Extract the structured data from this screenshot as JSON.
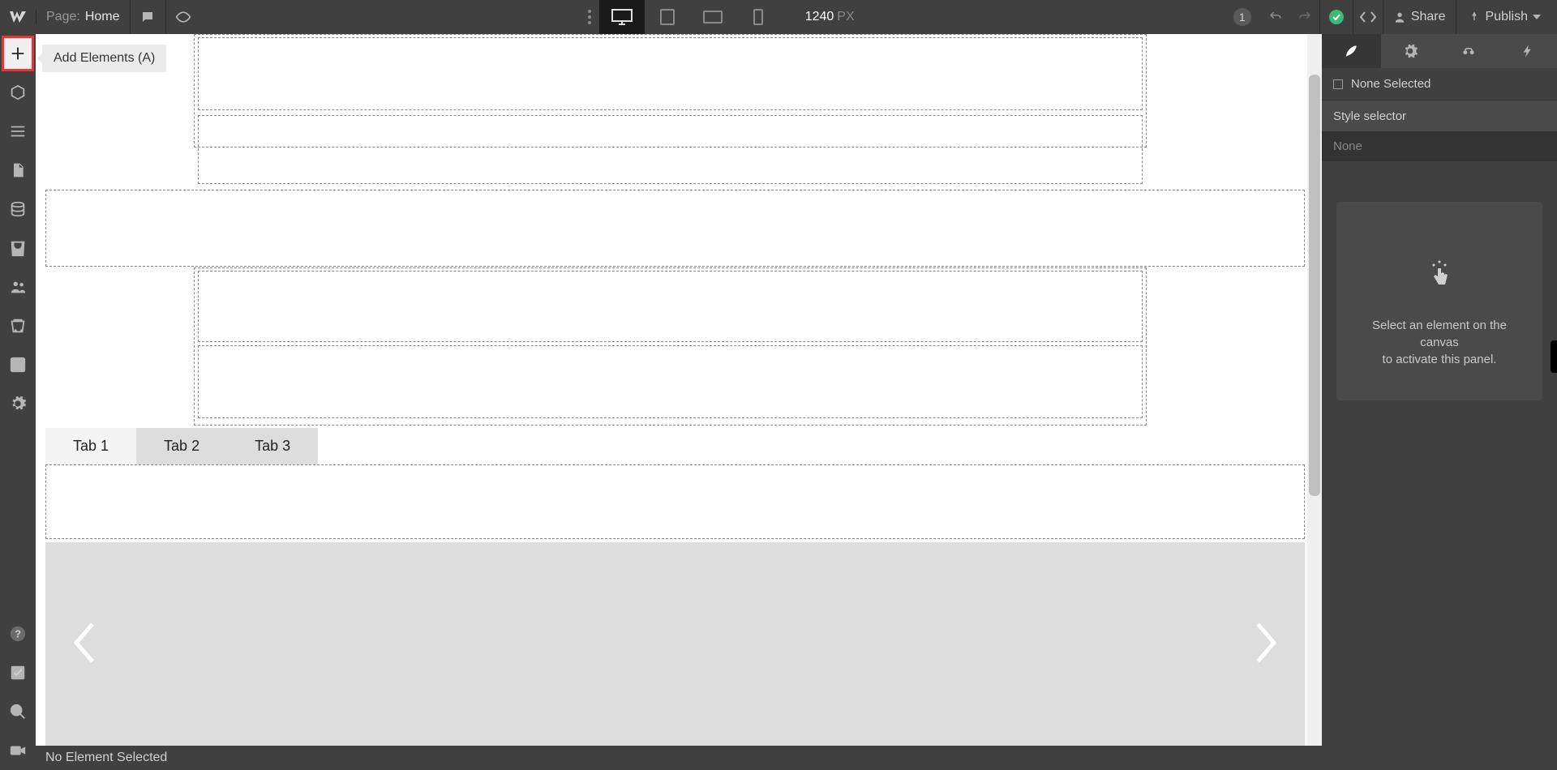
{
  "topbar": {
    "page_label": "Page:",
    "page_name": "Home",
    "width_value": "1240",
    "width_unit": "PX",
    "changes_badge": "1",
    "share_label": "Share",
    "publish_label": "Publish"
  },
  "tooltip": {
    "add_elements": "Add Elements (A)"
  },
  "canvas": {
    "tabs": [
      "Tab 1",
      "Tab 2",
      "Tab 3"
    ]
  },
  "breadcrumb": {
    "text": "No Element Selected"
  },
  "rightpanel": {
    "none_selected": "None Selected",
    "style_selector_label": "Style selector",
    "style_selector_value": "None",
    "empty_line1": "Select an element on the canvas",
    "empty_line2": "to activate this panel."
  }
}
